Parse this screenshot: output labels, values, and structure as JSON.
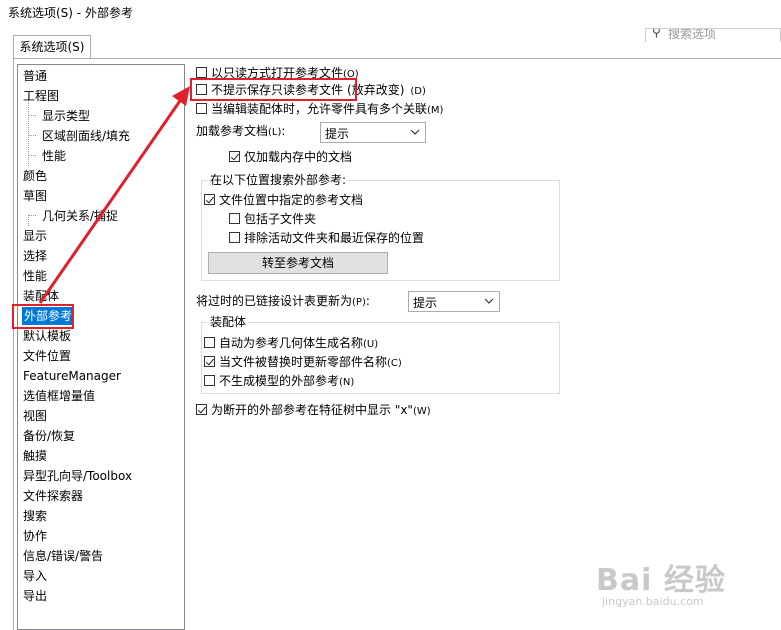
{
  "window": {
    "title": "系统选项(S) - 外部参考"
  },
  "tabs": [
    {
      "label": "系统选项(S)"
    }
  ],
  "search": {
    "placeholder": "搜索选项"
  },
  "tree": {
    "items": [
      {
        "label": "普通"
      },
      {
        "label": "工程图"
      },
      {
        "label": "显示类型"
      },
      {
        "label": "区域剖面线/填充"
      },
      {
        "label": "性能"
      },
      {
        "label": "颜色"
      },
      {
        "label": "草图"
      },
      {
        "label": "几何关系/捕捉"
      },
      {
        "label": "显示"
      },
      {
        "label": "选择"
      },
      {
        "label": "性能"
      },
      {
        "label": "装配体"
      },
      {
        "label": "外部参考"
      },
      {
        "label": "默认模板"
      },
      {
        "label": "文件位置"
      },
      {
        "label": "FeatureManager"
      },
      {
        "label": "选值框增量值"
      },
      {
        "label": "视图"
      },
      {
        "label": "备份/恢复"
      },
      {
        "label": "触摸"
      },
      {
        "label": "异型孔向导/Toolbox"
      },
      {
        "label": "文件探索器"
      },
      {
        "label": "搜索"
      },
      {
        "label": "协作"
      },
      {
        "label": "信息/错误/警告"
      },
      {
        "label": "导入"
      },
      {
        "label": "导出"
      }
    ]
  },
  "options": {
    "open_readonly": {
      "label": "以只读方式打开参考文件",
      "shortcut": "(O)",
      "checked": false
    },
    "no_prompt_save": {
      "label": "不提示保存只读参考文件",
      "suffix": "(放弃改变)",
      "shortcut": "(D)",
      "checked": false
    },
    "multi_context": {
      "label": "当编辑装配体时，允许零件具有多个关联",
      "shortcut": "(M)",
      "checked": false
    },
    "load_refs": {
      "label": "加载参考文档",
      "shortcut": "(L)",
      "colon": ":",
      "value": "提示"
    },
    "load_in_memory": {
      "label": "仅加载内存中的文档",
      "checked": true
    },
    "search_group": {
      "title": "在以下位置搜索外部参考:"
    },
    "file_locations": {
      "label": "文件位置中指定的参考文档",
      "checked": true
    },
    "include_subfolders": {
      "label": "包括子文件夹",
      "checked": false
    },
    "exclude_active": {
      "label": "排除活动文件夹和最近保存的位置",
      "checked": false
    },
    "goto_button": {
      "label": "转至参考文档"
    },
    "update_design_table": {
      "label": "将过时的已链接设计表更新为",
      "shortcut": "(P)",
      "colon": ":",
      "value": "提示"
    },
    "assembly_group": {
      "title": "装配体"
    },
    "auto_name": {
      "label": "自动为参考几何体生成名称",
      "shortcut": "(U)",
      "checked": false
    },
    "update_names": {
      "label": "当文件被替换时更新零部件名称",
      "shortcut": "(C)",
      "checked": true
    },
    "no_model_refs": {
      "label": "不生成模型的外部参考",
      "shortcut": "(N)",
      "checked": false
    },
    "show_x": {
      "label": "为断开的外部参考在特征树中显示 \"x\"",
      "shortcut": "(W)",
      "checked": true
    }
  },
  "watermark": {
    "brand": "Bai 经验",
    "url": "jingyan.baidu.com"
  },
  "colors": {
    "highlight": "#e0202a",
    "selection": "#0078d7"
  }
}
